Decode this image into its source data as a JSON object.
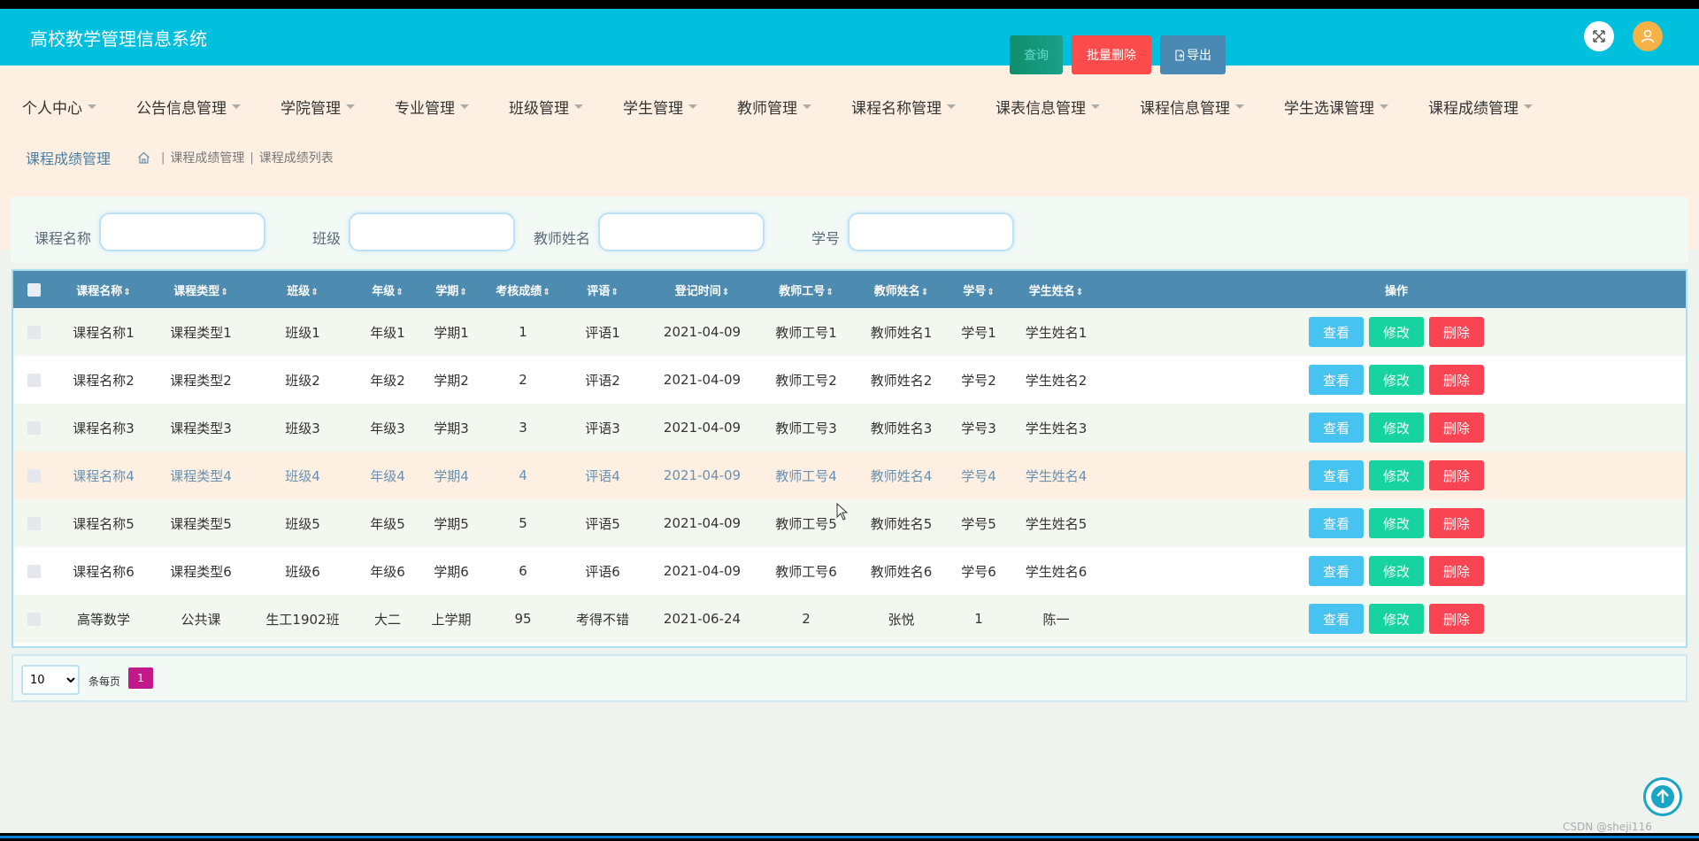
{
  "app": {
    "title": "高校教学管理信息系统"
  },
  "nav": {
    "items": [
      "个人中心",
      "公告信息管理",
      "学院管理",
      "专业管理",
      "班级管理",
      "学生管理",
      "教师管理",
      "课程名称管理",
      "课表信息管理",
      "课程信息管理",
      "学生选课管理",
      "课程成绩管理"
    ]
  },
  "breadcrumb": {
    "title": "课程成绩管理",
    "path": [
      "课程成绩管理",
      "课程成绩列表"
    ]
  },
  "search": {
    "course_name_label": "课程名称",
    "class_label": "班级",
    "teacher_name_label": "教师姓名",
    "student_no_label": "学号",
    "search_button": "查询",
    "batch_delete_button": "批量删除",
    "export_button": "导出"
  },
  "table": {
    "headers": [
      "课程名称",
      "课程类型",
      "班级",
      "年级",
      "学期",
      "考核成绩",
      "评语",
      "登记时间",
      "教师工号",
      "教师姓名",
      "学号",
      "学生姓名"
    ],
    "ops_header": "操作",
    "rows": [
      [
        "课程名称1",
        "课程类型1",
        "班级1",
        "年级1",
        "学期1",
        "1",
        "评语1",
        "2021-04-09",
        "教师工号1",
        "教师姓名1",
        "学号1",
        "学生姓名1"
      ],
      [
        "课程名称2",
        "课程类型2",
        "班级2",
        "年级2",
        "学期2",
        "2",
        "评语2",
        "2021-04-09",
        "教师工号2",
        "教师姓名2",
        "学号2",
        "学生姓名2"
      ],
      [
        "课程名称3",
        "课程类型3",
        "班级3",
        "年级3",
        "学期3",
        "3",
        "评语3",
        "2021-04-09",
        "教师工号3",
        "教师姓名3",
        "学号3",
        "学生姓名3"
      ],
      [
        "课程名称4",
        "课程类型4",
        "班级4",
        "年级4",
        "学期4",
        "4",
        "评语4",
        "2021-04-09",
        "教师工号4",
        "教师姓名4",
        "学号4",
        "学生姓名4"
      ],
      [
        "课程名称5",
        "课程类型5",
        "班级5",
        "年级5",
        "学期5",
        "5",
        "评语5",
        "2021-04-09",
        "教师工号5",
        "教师姓名5",
        "学号5",
        "学生姓名5"
      ],
      [
        "课程名称6",
        "课程类型6",
        "班级6",
        "年级6",
        "学期6",
        "6",
        "评语6",
        "2021-04-09",
        "教师工号6",
        "教师姓名6",
        "学号6",
        "学生姓名6"
      ],
      [
        "高等数学",
        "公共课",
        "生工1902班",
        "大二",
        "上学期",
        "95",
        "考得不错",
        "2021-06-24",
        "2",
        "张悦",
        "1",
        "陈一"
      ]
    ],
    "ops": {
      "view": "查看",
      "edit": "修改",
      "delete": "删除"
    },
    "sort_glyph": "⇕"
  },
  "pagination": {
    "page_size": "10",
    "per_page_label": "条每页",
    "current_page": "1"
  },
  "watermark": "CSDN @sheji116",
  "colors": {
    "topbar": "#00c0de",
    "navbar": "#fdf0e2",
    "table_header": "#4d8bb1",
    "view": "#46c3f0",
    "edit": "#17d3a0",
    "delete": "#f94454",
    "page_active": "#c1198a"
  }
}
